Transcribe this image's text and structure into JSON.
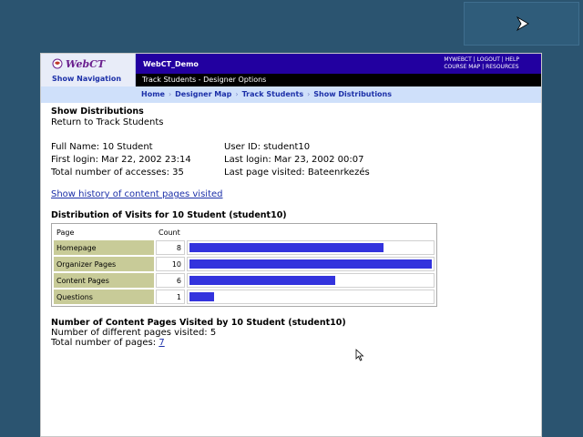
{
  "header": {
    "logo_text": "WebCT",
    "show_navigation": "Show Navigation",
    "course_name": "WebCT_Demo",
    "utility_links": [
      "MYWEBCT",
      "LOGOUT",
      "HELP",
      "COURSE MAP",
      "RESOURCES"
    ],
    "trail": "Track Students - Designer Options"
  },
  "breadcrumbs": [
    "Home",
    "Designer Map",
    "Track Students",
    "Show Distributions"
  ],
  "page": {
    "title": "Show Distributions",
    "return_link": "Return to Track Students"
  },
  "student": {
    "full_name": "Full Name: 10 Student",
    "user_id": "User ID: student10",
    "first_login": "First login: Mar 22, 2002 23:14",
    "last_login": "Last login: Mar 23, 2002 00:07",
    "total_accesses": "Total number of accesses: 35",
    "last_page": "Last page visited: Bateenrkezés"
  },
  "history_link": "Show history of content pages visited",
  "distribution": {
    "title": "Distribution of Visits for 10 Student (student10)",
    "headers": [
      "Page",
      "Count"
    ],
    "max": 10,
    "rows": [
      {
        "page": "Homepage",
        "count": 8
      },
      {
        "page": "Organizer Pages",
        "count": 10
      },
      {
        "page": "Content Pages",
        "count": 6
      },
      {
        "page": "Questions",
        "count": 1
      }
    ]
  },
  "content_pages": {
    "title": "Number of Content Pages Visited by 10 Student (student10)",
    "different_label": "Number of different pages visited:",
    "different_value": "5",
    "total_label": "Total number of pages:",
    "total_value": "7"
  },
  "colors": {
    "bar": "#3333dd",
    "page_cell": "#c8cb98",
    "banner": "#2200a0"
  }
}
